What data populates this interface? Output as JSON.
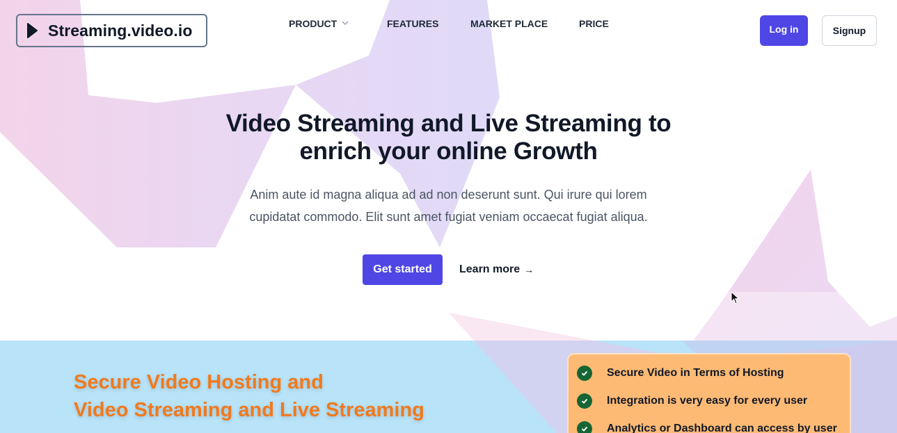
{
  "header": {
    "logo_text": "Streaming.video.io",
    "nav": [
      {
        "label": "PRODUCT",
        "has_dropdown": true
      },
      {
        "label": "FEATURES"
      },
      {
        "label": "MARKET PLACE"
      },
      {
        "label": "PRICE"
      }
    ],
    "login_label": "Log in",
    "signup_label": "Signup"
  },
  "hero": {
    "title": "Video Streaming and Live Streaming to enrich your online Growth",
    "subtitle": "Anim aute id magna aliqua ad ad non deserunt sunt. Qui irure qui lorem cupidatat commodo. Elit sunt amet fugiat veniam occaecat fugiat aliqua.",
    "cta_primary": "Get started",
    "cta_secondary": "Learn more",
    "cta_secondary_arrow": "→"
  },
  "section": {
    "title_line1": "Secure Video Hosting and",
    "title_line2": "Video Streaming and Live Streaming",
    "features": [
      "Secure Video in Terms of Hosting",
      "Integration is very easy for every user",
      "Analytics or Dashboard can access by user"
    ]
  },
  "colors": {
    "primary": "#4f46e5",
    "section_bg": "#b9e3f8",
    "section_title": "#f07a1e",
    "card_bg": "#fdba74",
    "check_bg": "#166534"
  }
}
